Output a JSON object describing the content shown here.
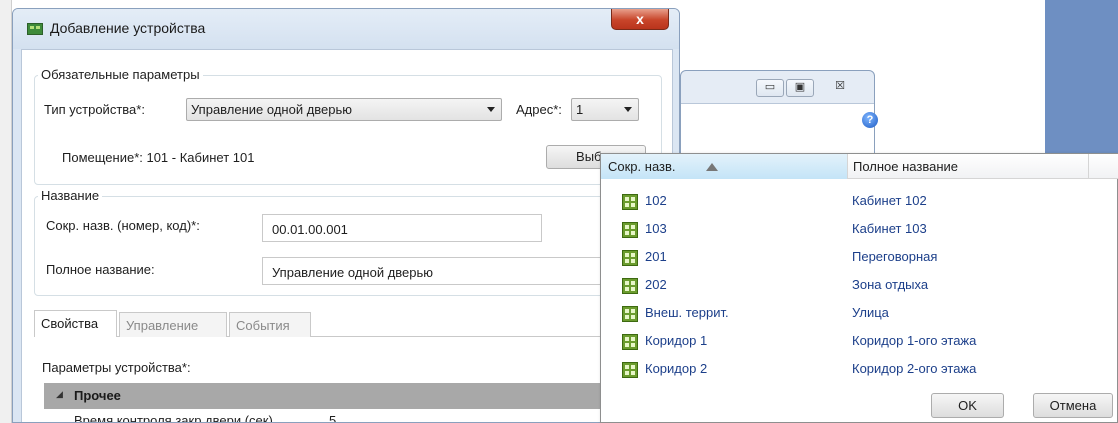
{
  "dialog": {
    "title": "Добавление устройства",
    "close_glyph": "x"
  },
  "required": {
    "legend": "Обязательные параметры",
    "device_type_label": "Тип устройства*:",
    "device_type_value": "Управление одной дверью",
    "address_label": "Адрес*:",
    "address_value": "1",
    "room_label": "Помещение*: 101 - Кабинет 101",
    "choose_button": "Выбра"
  },
  "name_group": {
    "legend": "Название",
    "short_label": "Сокр. назв. (номер, код)*:",
    "short_value": "00.01.00.001",
    "full_label": "Полное название:",
    "full_value": "Управление одной дверью"
  },
  "tabs": [
    {
      "label": "Свойства",
      "active": true
    },
    {
      "label": "Управление",
      "active": false
    },
    {
      "label": "События",
      "active": false
    }
  ],
  "properties": {
    "params_label": "Параметры устройства*:",
    "category": "Прочее",
    "category_glyph": "◢",
    "row_label": "Время контроля закр.двери (сек)",
    "row_value": "5"
  },
  "window2": {
    "minimize_glyph": "▭",
    "maximize_glyph": "▣",
    "close_glyph": "☒",
    "help_glyph": "?"
  },
  "room_picker": {
    "col_short": "Сокр. назв.",
    "col_full": "Полное название",
    "rows": [
      {
        "short": "102",
        "full": "Кабинет 102"
      },
      {
        "short": "103",
        "full": "Кабинет 103"
      },
      {
        "short": "201",
        "full": "Переговорная"
      },
      {
        "short": "202",
        "full": "Зона отдыха"
      },
      {
        "short": "Внеш. террит.",
        "full": "Улица"
      },
      {
        "short": "Коридор 1",
        "full": "Коридор 1-ого этажа"
      },
      {
        "short": "Коридор 2",
        "full": "Коридор 2-ого этажа"
      }
    ],
    "ok": "OK",
    "cancel": "Отмена"
  }
}
